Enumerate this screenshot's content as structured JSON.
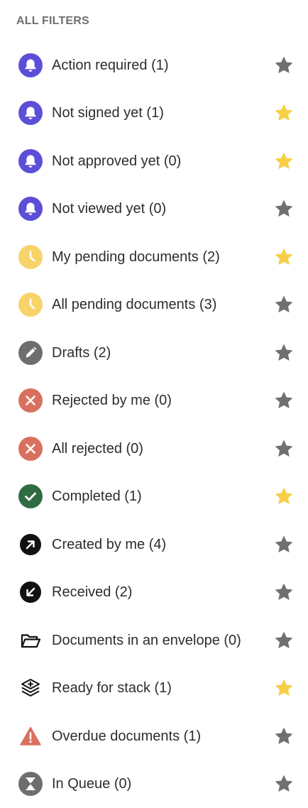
{
  "header": {
    "title": "ALL FILTERS"
  },
  "colors": {
    "purple": "#5b4fd8",
    "yellow": "#f7d46a",
    "gray": "#6e6e6e",
    "red": "#d9705f",
    "green": "#2f6b43",
    "black": "#111111",
    "star_on": "#f6cf46",
    "star_off": "#707070"
  },
  "filters": [
    {
      "label": "Action required (1)",
      "icon": "bell-icon",
      "starred": false
    },
    {
      "label": "Not signed yet (1)",
      "icon": "bell-icon",
      "starred": true
    },
    {
      "label": "Not approved yet (0)",
      "icon": "bell-icon",
      "starred": true
    },
    {
      "label": "Not viewed yet (0)",
      "icon": "bell-icon",
      "starred": false
    },
    {
      "label": "My pending documents (2)",
      "icon": "clock-icon",
      "starred": true
    },
    {
      "label": "All pending documents (3)",
      "icon": "clock-icon",
      "starred": false
    },
    {
      "label": "Drafts (2)",
      "icon": "pencil-icon",
      "starred": false
    },
    {
      "label": "Rejected by me (0)",
      "icon": "x-circle-icon",
      "starred": false
    },
    {
      "label": "All rejected (0)",
      "icon": "x-circle-icon",
      "starred": false
    },
    {
      "label": "Completed (1)",
      "icon": "check-circle-icon",
      "starred": true
    },
    {
      "label": "Created by me (4)",
      "icon": "arrow-up-right-icon",
      "starred": false
    },
    {
      "label": "Received (2)",
      "icon": "arrow-down-left-icon",
      "starred": false
    },
    {
      "label": "Documents in an envelope (0)",
      "icon": "folder-open-icon",
      "starred": false
    },
    {
      "label": "Ready for stack (1)",
      "icon": "stack-icon",
      "starred": true
    },
    {
      "label": "Overdue documents (1)",
      "icon": "warning-icon",
      "starred": false
    },
    {
      "label": "In Queue (0)",
      "icon": "hourglass-icon",
      "starred": false
    }
  ]
}
